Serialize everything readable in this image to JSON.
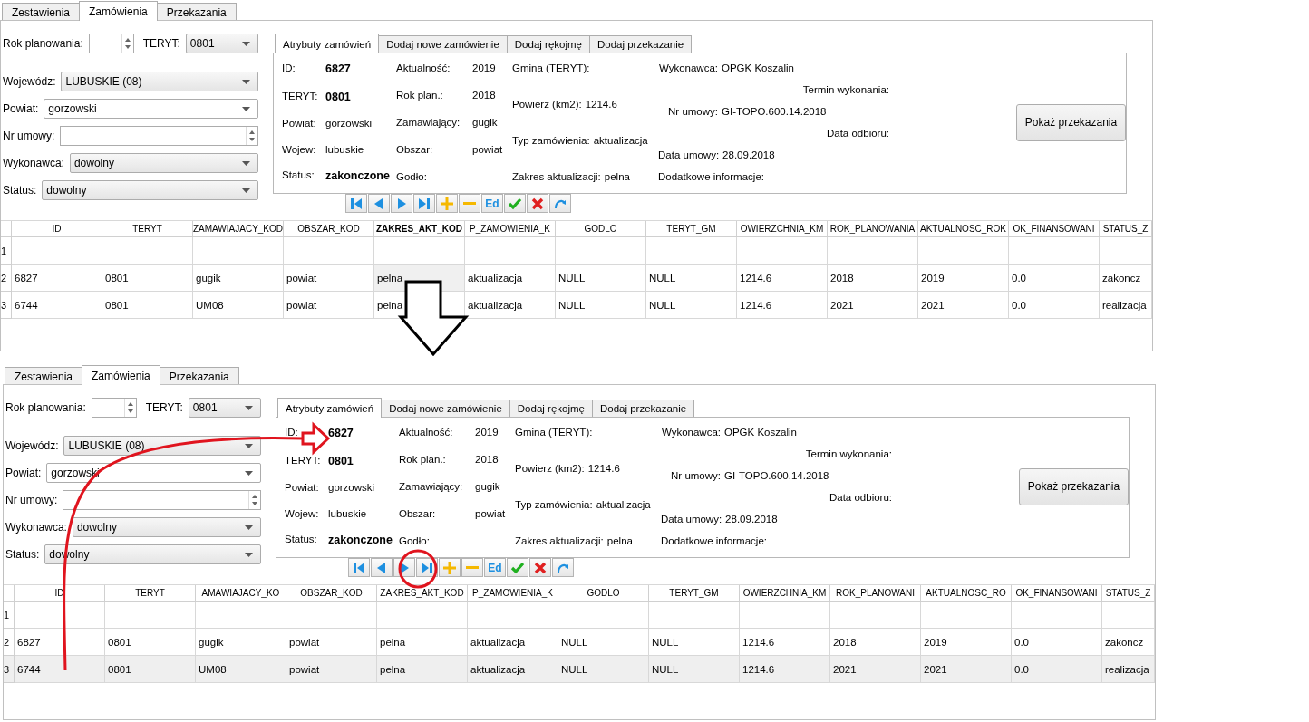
{
  "panels": [
    {
      "tabs": [
        {
          "label": "Zestawienia",
          "selected": false
        },
        {
          "label": "Zamówienia",
          "selected": true
        },
        {
          "label": "Przekazania",
          "selected": false
        }
      ],
      "form_rows": [
        [
          {
            "kind": "spinbox",
            "label": "Rok planowania:"
          },
          {
            "kind": "combo",
            "label": "TERYT:",
            "value": "0801"
          }
        ],
        [
          {
            "kind": "combo",
            "label": "Wojewódz:",
            "value": "LUBUSKIE (08)"
          }
        ],
        [
          {
            "kind": "editcombo",
            "label": "Powiat:",
            "value": "gorzowski"
          }
        ],
        [
          {
            "kind": "spinbox",
            "label": "Nr umowy:"
          }
        ],
        [
          {
            "kind": "combo",
            "label": "Wykonawca:",
            "value": "dowolny"
          }
        ],
        [
          {
            "kind": "combo",
            "label": "Status:",
            "value": "dowolny"
          }
        ]
      ],
      "detail_tabs": [
        {
          "label": "Atrybuty zamówień",
          "selected": true
        },
        {
          "label": "Dodaj nowe zamówienie",
          "selected": false
        },
        {
          "label": "Dodaj rękojmę",
          "selected": false
        },
        {
          "label": "Dodaj przekazanie",
          "selected": false
        }
      ],
      "detail_columns": [
        [
          {
            "label": "ID:",
            "value": "6827",
            "bold": true
          },
          {
            "label": "TERYT:",
            "value": "0801",
            "bold": true
          },
          {
            "label": "Powiat:",
            "value": "gorzowski",
            "bold": false
          },
          {
            "label": "Wojew:",
            "value": "lubuskie",
            "bold": false
          },
          {
            "label": "Status:",
            "value": "zakonczone",
            "bold": true
          }
        ],
        [
          {
            "label": "Aktualność:",
            "value": "2019",
            "bold": false
          },
          {
            "label": "Rok plan.:",
            "value": "2018",
            "bold": false
          },
          {
            "label": "Zamawiający:",
            "value": "gugik",
            "bold": false
          },
          {
            "label": "Obszar:",
            "value": "powiat",
            "bold": false
          },
          {
            "label": "Godło:",
            "bold": false
          }
        ],
        [
          {
            "label": "Gmina (TERYT):",
            "bold": false
          },
          {
            "label": "Powierz (km2):",
            "value": "1214.6",
            "bold": false
          },
          {
            "label": "Typ zamówienia:",
            "value": "aktualizacja",
            "bold": false
          },
          {
            "label": "Zakres aktualizacji:",
            "value": "pelna",
            "bold": false
          }
        ],
        [
          {
            "label": "Wykonawca:",
            "value": "OPGK Koszalin",
            "bold": false
          },
          {
            "label": "Nr umowy:",
            "value": "GI-TOPO.600.14.2018",
            "bold": false
          },
          {
            "label": "Data umowy:",
            "value": "28.09.2018",
            "bold": false
          },
          {
            "label": "Dodatkowe informacje:",
            "bold": false
          }
        ],
        [
          {
            "label": "Termin wykonania:",
            "bold": false
          },
          {
            "label": "Data odbioru:",
            "bold": false
          }
        ]
      ],
      "show_button": "Pokaż przekazania",
      "toolbar": [
        {
          "kind": "first"
        },
        {
          "kind": "prev"
        },
        {
          "kind": "next"
        },
        {
          "kind": "last"
        },
        {
          "kind": "add"
        },
        {
          "kind": "remove"
        },
        {
          "kind": "edit",
          "text": "Ed"
        },
        {
          "kind": "accept"
        },
        {
          "kind": "cancel"
        },
        {
          "kind": "refresh"
        }
      ],
      "columns": [
        {
          "label": "ID",
          "selected": false
        },
        {
          "label": "TERYT",
          "selected": false
        },
        {
          "label": "ZAMAWIAJACY_KOD",
          "selected": false
        },
        {
          "label": "OBSZAR_KOD",
          "selected": false
        },
        {
          "label": "ZAKRES_AKT_KOD",
          "selected": true
        },
        {
          "label": "P_ZAMOWIENIA_K",
          "selected": false
        },
        {
          "label": "GODLO",
          "selected": false
        },
        {
          "label": "TERYT_GM",
          "selected": false
        },
        {
          "label": "OWIERZCHNIA_KM",
          "selected": false
        },
        {
          "label": "ROK_PLANOWANIA",
          "selected": false
        },
        {
          "label": "AKTUALNOSC_ROK",
          "selected": false
        },
        {
          "label": "OK_FINANSOWANI",
          "selected": false
        },
        {
          "label": "STATUS_Z",
          "selected": false
        }
      ],
      "rows": [
        {
          "number": "1",
          "selected": false,
          "current": false,
          "cells": []
        },
        {
          "number": "2",
          "selected": false,
          "current": true,
          "cells": [
            "6827",
            "0801",
            "gugik",
            "powiat",
            "pelna",
            "aktualizacja",
            "NULL",
            "NULL",
            "1214.6",
            "2018",
            "2019",
            "0.0",
            "zakoncz"
          ]
        },
        {
          "number": "3",
          "selected": false,
          "current": false,
          "cells": [
            "6744",
            "0801",
            "UM08",
            "powiat",
            "pelna",
            "aktualizacja",
            "NULL",
            "NULL",
            "1214.6",
            "2021",
            "2021",
            "0.0",
            "realizacja"
          ]
        }
      ]
    },
    {
      "tabs": [
        {
          "label": "Zestawienia",
          "selected": false
        },
        {
          "label": "Zamówienia",
          "selected": true
        },
        {
          "label": "Przekazania",
          "selected": false
        }
      ],
      "form_rows": [
        [
          {
            "kind": "spinbox",
            "label": "Rok planowania:"
          },
          {
            "kind": "combo",
            "label": "TERYT:",
            "value": "0801"
          }
        ],
        [
          {
            "kind": "combo",
            "label": "Wojewódz:",
            "value": "LUBUSKIE (08)"
          }
        ],
        [
          {
            "kind": "editcombo",
            "label": "Powiat:",
            "value": "gorzowski"
          }
        ],
        [
          {
            "kind": "spinbox",
            "label": "Nr umowy:"
          }
        ],
        [
          {
            "kind": "combo",
            "label": "Wykonawca:",
            "value": "dowolny"
          }
        ],
        [
          {
            "kind": "combo",
            "label": "Status:",
            "value": "dowolny"
          }
        ]
      ],
      "detail_tabs": [
        {
          "label": "Atrybuty zamówień",
          "selected": true
        },
        {
          "label": "Dodaj nowe zamówienie",
          "selected": false
        },
        {
          "label": "Dodaj rękojmę",
          "selected": false
        },
        {
          "label": "Dodaj przekazanie",
          "selected": false
        }
      ],
      "detail_columns": [
        [
          {
            "label": "ID:",
            "value": "6827",
            "bold": true
          },
          {
            "label": "TERYT:",
            "value": "0801",
            "bold": true
          },
          {
            "label": "Powiat:",
            "value": "gorzowski",
            "bold": false
          },
          {
            "label": "Wojew:",
            "value": "lubuskie",
            "bold": false
          },
          {
            "label": "Status:",
            "value": "zakonczone",
            "bold": true
          }
        ],
        [
          {
            "label": "Aktualność:",
            "value": "2019",
            "bold": false
          },
          {
            "label": "Rok plan.:",
            "value": "2018",
            "bold": false
          },
          {
            "label": "Zamawiający:",
            "value": "gugik",
            "bold": false
          },
          {
            "label": "Obszar:",
            "value": "powiat",
            "bold": false
          },
          {
            "label": "Godło:",
            "bold": false
          }
        ],
        [
          {
            "label": "Gmina (TERYT):",
            "bold": false
          },
          {
            "label": "Powierz (km2):",
            "value": "1214.6",
            "bold": false
          },
          {
            "label": "Typ zamówienia:",
            "value": "aktualizacja",
            "bold": false
          },
          {
            "label": "Zakres aktualizacji:",
            "value": "pelna",
            "bold": false
          }
        ],
        [
          {
            "label": "Wykonawca:",
            "value": "OPGK Koszalin",
            "bold": false
          },
          {
            "label": "Nr umowy:",
            "value": "GI-TOPO.600.14.2018",
            "bold": false
          },
          {
            "label": "Data umowy:",
            "value": "28.09.2018",
            "bold": false
          },
          {
            "label": "Dodatkowe informacje:",
            "bold": false
          }
        ],
        [
          {
            "label": "Termin wykonania:",
            "bold": false
          },
          {
            "label": "Data odbioru:",
            "bold": false
          }
        ]
      ],
      "show_button": "Pokaż przekazania",
      "toolbar": [
        {
          "kind": "first"
        },
        {
          "kind": "prev"
        },
        {
          "kind": "next"
        },
        {
          "kind": "last"
        },
        {
          "kind": "add"
        },
        {
          "kind": "remove"
        },
        {
          "kind": "edit",
          "text": "Ed"
        },
        {
          "kind": "accept"
        },
        {
          "kind": "cancel"
        },
        {
          "kind": "refresh"
        }
      ],
      "columns": [
        {
          "label": "ID",
          "selected": false
        },
        {
          "label": "TERYT",
          "selected": false
        },
        {
          "label": "AMAWIAJACY_KO",
          "selected": false
        },
        {
          "label": "OBSZAR_KOD",
          "selected": false
        },
        {
          "label": "ZAKRES_AKT_KOD",
          "selected": false
        },
        {
          "label": "P_ZAMOWIENIA_K",
          "selected": false
        },
        {
          "label": "GODLO",
          "selected": false
        },
        {
          "label": "TERYT_GM",
          "selected": false
        },
        {
          "label": "OWIERZCHNIA_KM",
          "selected": false
        },
        {
          "label": "ROK_PLANOWANI",
          "selected": false
        },
        {
          "label": "AKTUALNOSC_RO",
          "selected": false
        },
        {
          "label": "OK_FINANSOWANI",
          "selected": false
        },
        {
          "label": "STATUS_Z",
          "selected": false
        }
      ],
      "rows": [
        {
          "number": "1",
          "selected": false,
          "cells": []
        },
        {
          "number": "2",
          "selected": false,
          "cells": [
            "6827",
            "0801",
            "gugik",
            "powiat",
            "pelna",
            "aktualizacja",
            "NULL",
            "NULL",
            "1214.6",
            "2018",
            "2019",
            "0.0",
            "zakoncz"
          ]
        },
        {
          "number": "3",
          "selected": true,
          "cells": [
            "6744",
            "0801",
            "UM08",
            "powiat",
            "pelna",
            "aktualizacja",
            "NULL",
            "NULL",
            "1214.6",
            "2021",
            "2021",
            "0.0",
            "realizacja"
          ]
        }
      ]
    }
  ],
  "annotations": [
    {
      "kind": "down_arrow"
    },
    {
      "kind": "curved_arrow"
    },
    {
      "kind": "circle"
    }
  ]
}
